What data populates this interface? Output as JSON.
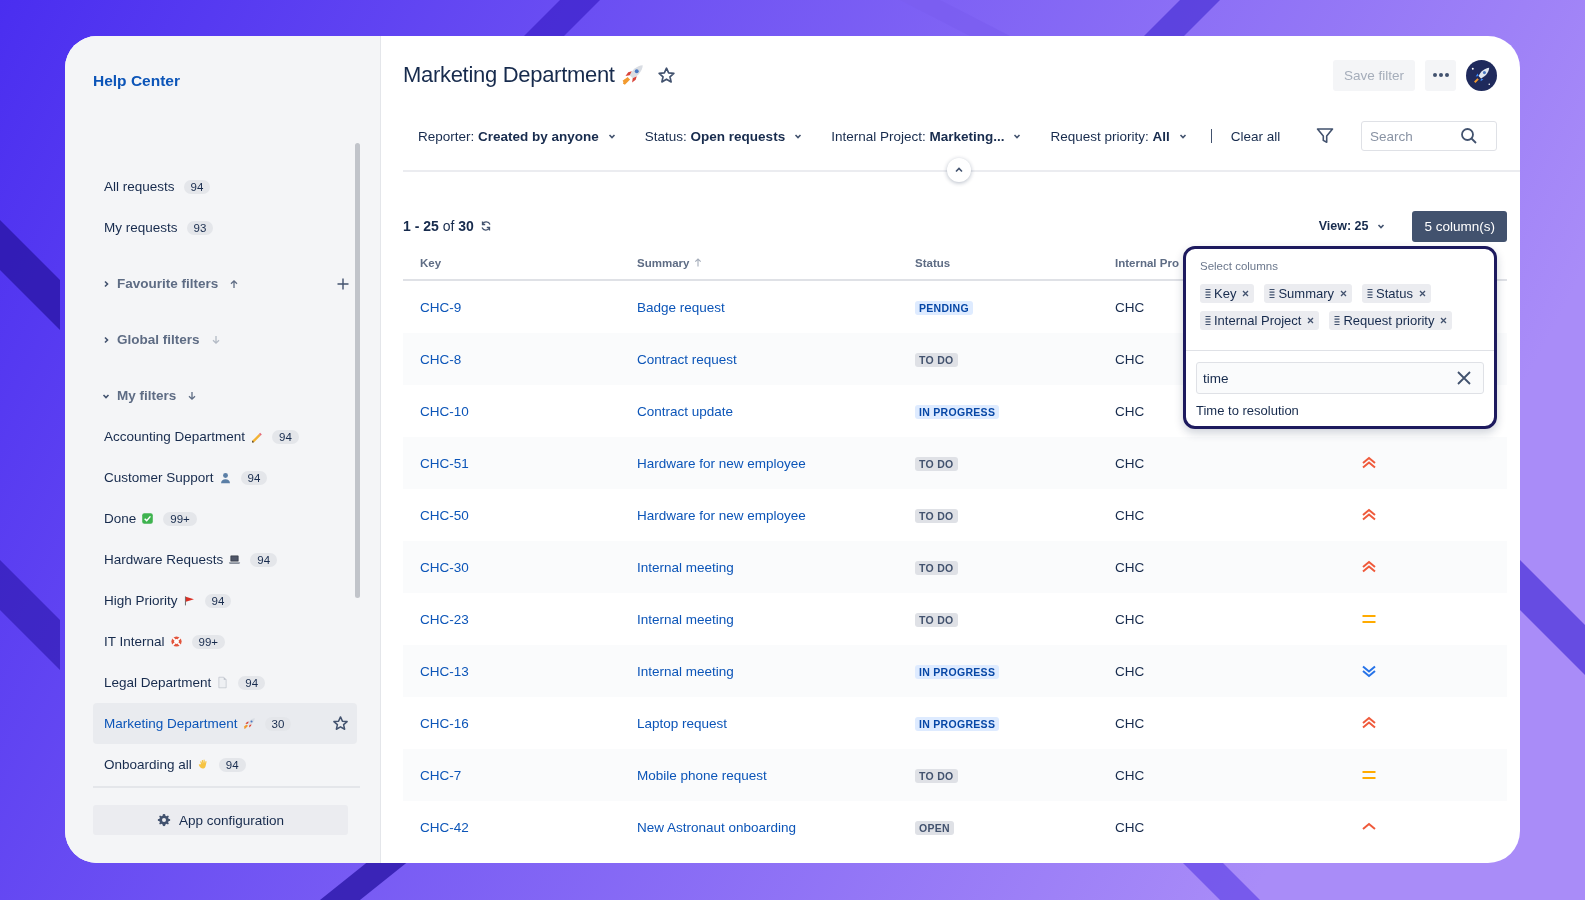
{
  "sidebar": {
    "title": "Help Center",
    "items": [
      {
        "label": "All requests",
        "count": "94"
      },
      {
        "label": "My requests",
        "count": "93"
      }
    ],
    "sections": [
      {
        "label": "Favourite filters",
        "expanded": false,
        "sorted_up": true,
        "sort_active": true,
        "can_add": true
      },
      {
        "label": "Global filters",
        "expanded": false,
        "sorted_up": false,
        "sort_active": false,
        "can_add": false
      },
      {
        "label": "My filters",
        "expanded": true,
        "sorted_up": false,
        "sort_active": true,
        "can_add": false,
        "filters": [
          {
            "label": "Accounting Department",
            "kind": "pencil",
            "count": "94",
            "selected": false
          },
          {
            "label": "Customer Support",
            "kind": "person",
            "count": "94",
            "selected": false
          },
          {
            "label": "Done",
            "kind": "check",
            "count": "99+",
            "selected": false
          },
          {
            "label": "Hardware Requests",
            "kind": "laptop",
            "count": "94",
            "selected": false
          },
          {
            "label": "High Priority",
            "kind": "flag",
            "count": "94",
            "selected": false
          },
          {
            "label": "IT Internal",
            "kind": "lifebuoy",
            "count": "99+",
            "selected": false
          },
          {
            "label": "Legal Department",
            "kind": "document",
            "count": "94",
            "selected": false
          },
          {
            "label": "Marketing Department",
            "kind": "rocket",
            "count": "30",
            "selected": true
          },
          {
            "label": "Onboarding all",
            "kind": "hand",
            "count": "94",
            "selected": false
          }
        ]
      }
    ],
    "footer_button": "App configuration"
  },
  "header": {
    "title": "Marketing Department",
    "kind": "rocket",
    "starred": false,
    "save_filter": {
      "label": "Save filter",
      "disabled": true
    }
  },
  "filters": [
    {
      "label": "Reporter:",
      "value": "Created by anyone"
    },
    {
      "label": "Status:",
      "value": "Open requests"
    },
    {
      "label": "Internal Project:",
      "value": "Marketing..."
    },
    {
      "label": "Request priority:",
      "value": "All"
    }
  ],
  "clear_all": "Clear all",
  "search": {
    "placeholder": "Search"
  },
  "results": "**1 - 25** of **30**",
  "view": "View: 25",
  "columns_button": "5 column(s)",
  "table": {
    "columns": [
      {
        "label": "Key",
        "sorted": false
      },
      {
        "label": "Summary",
        "sorted": true
      },
      {
        "label": "Status",
        "sorted": false
      },
      {
        "label": "Internal Pro",
        "sorted": false
      }
    ],
    "rows": [
      {
        "key": "CHC-9",
        "summary": "Badge request",
        "status": {
          "text": "PENDING",
          "color": "#deebff"
        },
        "project": "CHC"
      },
      {
        "key": "CHC-8",
        "summary": "Contract request",
        "status": {
          "text": "TO DO",
          "color": "#dfe1e6"
        },
        "project": "CHC"
      },
      {
        "key": "CHC-10",
        "summary": "Contract update",
        "status": {
          "text": "IN PROGRESS",
          "color": "#deebff"
        },
        "project": "CHC"
      },
      {
        "key": "CHC-51",
        "summary": "Hardware for new employee",
        "status": {
          "text": "TO DO",
          "color": "#dfe1e6"
        },
        "project": "CHC",
        "kind": "highest"
      },
      {
        "key": "CHC-50",
        "summary": "Hardware for new employee",
        "status": {
          "text": "TO DO",
          "color": "#dfe1e6"
        },
        "project": "CHC",
        "kind": "highest"
      },
      {
        "key": "CHC-30",
        "summary": "Internal meeting",
        "status": {
          "text": "TO DO",
          "color": "#dfe1e6"
        },
        "project": "CHC",
        "kind": "highest"
      },
      {
        "key": "CHC-23",
        "summary": "Internal meeting",
        "status": {
          "text": "TO DO",
          "color": "#dfe1e6"
        },
        "project": "CHC",
        "kind": "medium"
      },
      {
        "key": "CHC-13",
        "summary": "Internal meeting",
        "status": {
          "text": "IN PROGRESS",
          "color": "#deebff"
        },
        "project": "CHC",
        "kind": "lowest"
      },
      {
        "key": "CHC-16",
        "summary": "Laptop request",
        "status": {
          "text": "IN PROGRESS",
          "color": "#deebff"
        },
        "project": "CHC",
        "kind": "highest"
      },
      {
        "key": "CHC-7",
        "summary": "Mobile phone request",
        "status": {
          "text": "TO DO",
          "color": "#dfe1e6"
        },
        "project": "CHC",
        "kind": "medium"
      },
      {
        "key": "CHC-42",
        "summary": "New Astronaut onboarding",
        "status": {
          "text": "OPEN",
          "color": "#dfe1e6"
        },
        "project": "CHC",
        "kind": "high"
      }
    ]
  },
  "column_picker": {
    "title": "Select columns",
    "selected": [
      "Key",
      "Summary",
      "Status",
      "Internal Project",
      "Request priority"
    ],
    "query": "time",
    "options": [
      "Time to resolution"
    ]
  }
}
